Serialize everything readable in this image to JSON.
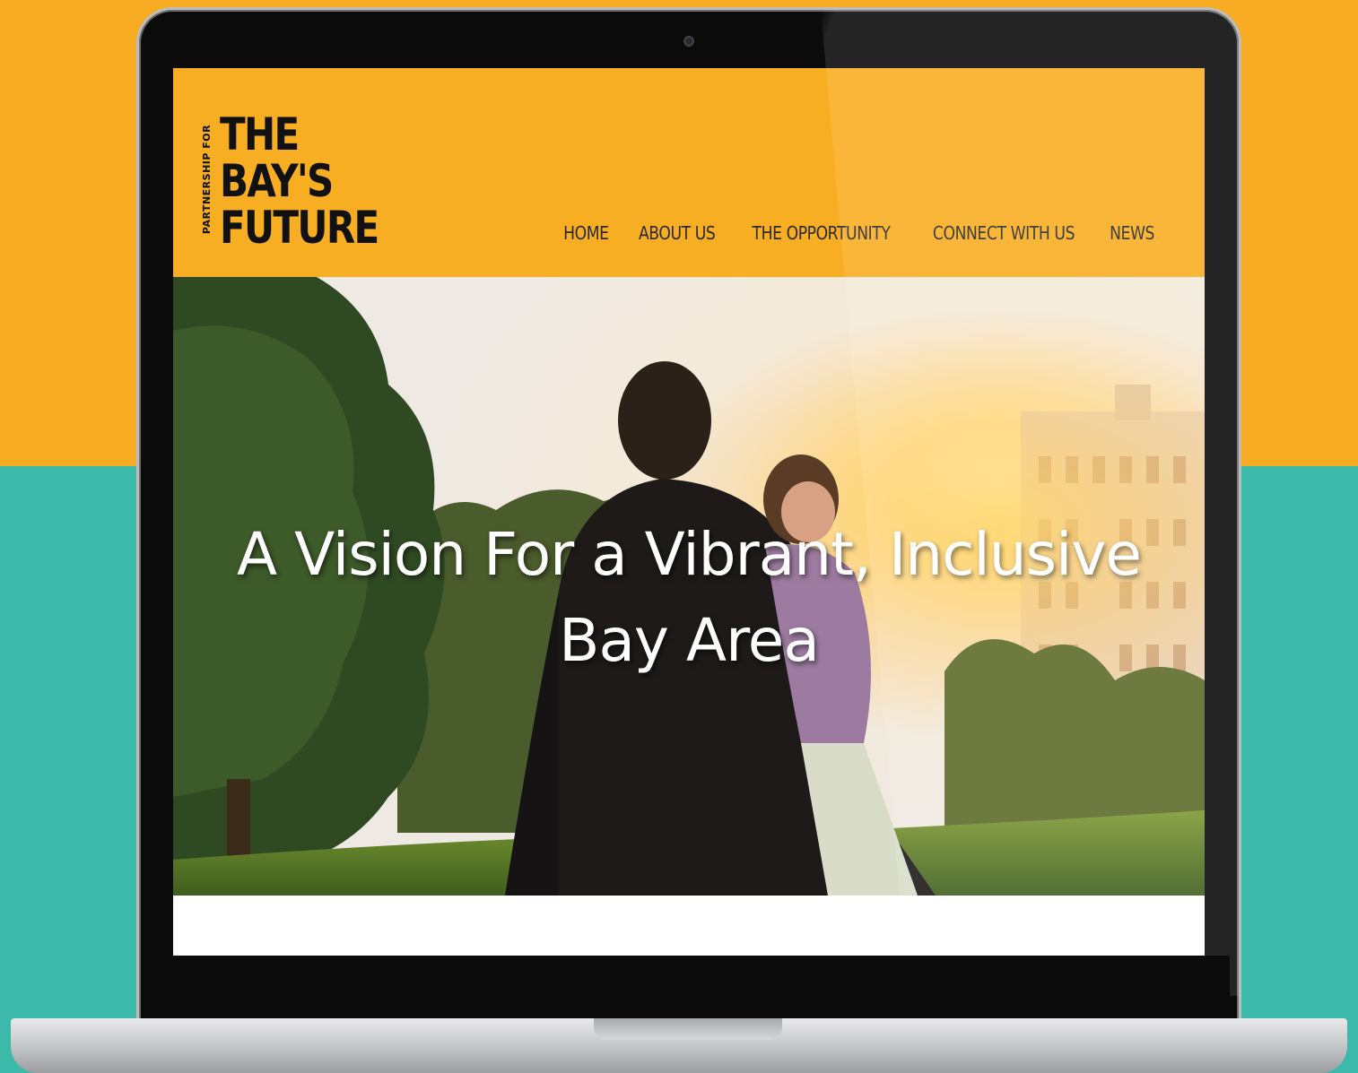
{
  "logo": {
    "vertical_text": "PARTNERSHIP FOR",
    "lines": [
      "THE",
      "BAY'S",
      "FUTURE"
    ]
  },
  "nav": {
    "items": [
      {
        "label": "HOME"
      },
      {
        "label": "ABOUT US"
      },
      {
        "label": "THE OPPORTUNITY"
      },
      {
        "label": "CONNECT WITH US"
      },
      {
        "label": "NEWS"
      }
    ]
  },
  "hero": {
    "title_line1": "A Vision For a Vibrant, Inclusive",
    "title_line2": "Bay Area"
  },
  "colors": {
    "background_top": "#f7ab22",
    "background_bottom": "#3cb9a8",
    "header": "#f8ae22"
  }
}
